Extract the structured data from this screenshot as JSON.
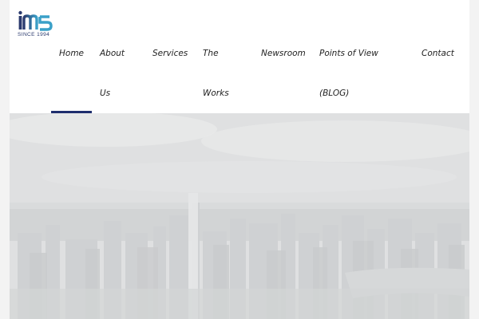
{
  "logo": {
    "brand": "ims",
    "tagline": "SINCE 1994",
    "colors": {
      "primary": "#2b3a6e",
      "accent": "#3aa0c8"
    }
  },
  "nav": {
    "items": [
      {
        "key": "home",
        "lines": [
          "Home"
        ],
        "active": true
      },
      {
        "key": "about-us",
        "lines": [
          "About",
          "Us"
        ]
      },
      {
        "key": "services",
        "lines": [
          "Services"
        ]
      },
      {
        "key": "the-works",
        "lines": [
          "The",
          "Works"
        ]
      },
      {
        "key": "newsroom",
        "lines": [
          "Newsroom"
        ]
      },
      {
        "key": "points-of-view-blog",
        "lines": [
          "Points of View",
          "(BLOG)"
        ]
      },
      {
        "key": "contact",
        "lines": [
          "Contact"
        ]
      }
    ],
    "active_color": "#1f2e6e"
  },
  "hero": {
    "image": "faded-aerial-city-skyline"
  }
}
